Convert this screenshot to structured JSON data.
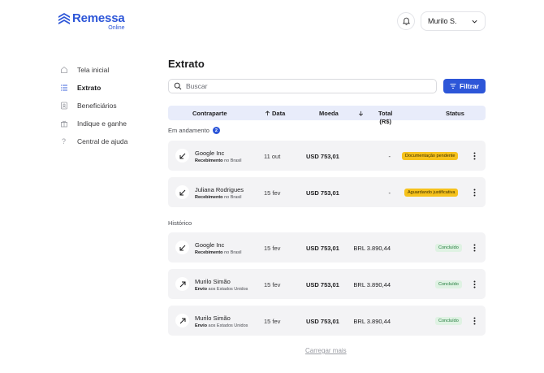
{
  "brand": {
    "name": "Remessa",
    "sub": "Online",
    "color": "#2d56d8"
  },
  "header": {
    "user_name": "Murilo S.",
    "bell_icon": "bell-icon",
    "dropdown_icon": "chevron-down-icon"
  },
  "sidebar": {
    "items": [
      {
        "label": "Tela inicial",
        "icon": "home-icon",
        "active": false
      },
      {
        "label": "Extrato",
        "icon": "list-icon",
        "active": true
      },
      {
        "label": "Beneficiários",
        "icon": "contact-icon",
        "active": false
      },
      {
        "label": "Indique e ganhe",
        "icon": "gift-icon",
        "active": false
      },
      {
        "label": "Central de ajuda",
        "icon": "help-icon",
        "active": false
      }
    ]
  },
  "main": {
    "title": "Extrato",
    "search_placeholder": "Buscar",
    "filter_label": "Filtrar",
    "columns": {
      "counterpart": "Contraparte",
      "date": "Data",
      "currency": "Moeda",
      "total_line1": "Total",
      "total_line2": "(R$)",
      "status": "Status"
    },
    "in_progress": {
      "label": "Em andamento",
      "count": "2",
      "rows": [
        {
          "name": "Google Inc",
          "desc_bold": "Recebimento",
          "desc_rest": " no Brasil",
          "date": "11 out",
          "amount": "USD 753,01",
          "total": "-",
          "status": "Documentação pendente",
          "status_type": "pending",
          "direction": "in"
        },
        {
          "name": "Juliana Rodrigues",
          "desc_bold": "Recebimento",
          "desc_rest": " no Brasil",
          "date": "15 fev",
          "amount": "USD 753,01",
          "total": "-",
          "status": "Aguardando justificativa",
          "status_type": "pending",
          "direction": "in"
        }
      ]
    },
    "history": {
      "label": "Histórico",
      "rows": [
        {
          "name": "Google Inc",
          "desc_bold": "Recebimento",
          "desc_rest": " no Brasil",
          "date": "15 fev",
          "amount": "USD 753,01",
          "total": "BRL 3.890,44",
          "status": "Concluído",
          "status_type": "done",
          "direction": "in"
        },
        {
          "name": "Murilo Simão",
          "desc_bold": "Envio",
          "desc_rest": " aos Estados Unidos",
          "date": "15 fev",
          "amount": "USD 753,01",
          "total": "BRL 3.890,44",
          "status": "Concluído",
          "status_type": "done",
          "direction": "out"
        },
        {
          "name": "Murilo Simão",
          "desc_bold": "Envio",
          "desc_rest": " aos Estados Unidos",
          "date": "15 fev",
          "amount": "USD 753,01",
          "total": "BRL 3.890,44",
          "status": "Concluído",
          "status_type": "done",
          "direction": "out"
        }
      ]
    },
    "load_more": "Carregar mais"
  }
}
